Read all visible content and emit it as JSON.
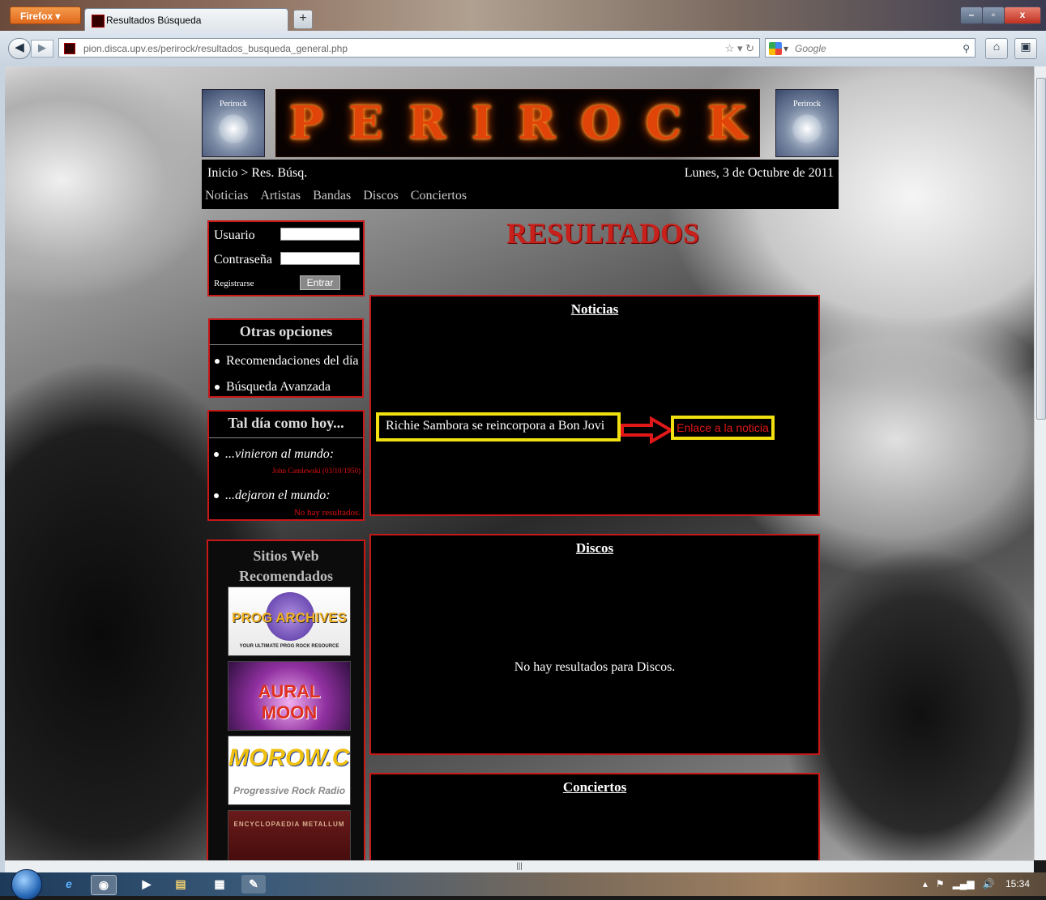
{
  "browser": {
    "menu_button": "Firefox",
    "tab_title": "Resultados Búsqueda",
    "newtab_label": "+",
    "url": "pion.disca.upv.es/perirock/resultados_busqueda_general.php",
    "search_engine_placeholder": "Google",
    "window_buttons": [
      "–",
      "▫",
      "x"
    ]
  },
  "site": {
    "logo_side_text": "Perirock",
    "logo_text": [
      "P",
      "E",
      "R",
      "I",
      "R",
      "O",
      "C",
      "K"
    ],
    "breadcrumb": "Inicio > Res. Búsq.",
    "date": "Lunes, 3 de Octubre de 2011",
    "nav": [
      "Noticias",
      "Artistas",
      "Bandas",
      "Discos",
      "Conciertos"
    ]
  },
  "login": {
    "user_label": "Usuario",
    "password_label": "Contraseña",
    "register_label": "Registrarse",
    "submit_label": "Entrar"
  },
  "options": {
    "title": "Otras opciones",
    "items": [
      "Recomendaciones del día",
      "Búsqueda Avanzada"
    ]
  },
  "on_this_day": {
    "title": "Tal día como hoy...",
    "born_label": "...vinieron al mundo:",
    "born_result": "John Camlewski (03/10/1950)",
    "died_label": "...dejaron el mundo:",
    "died_result": "No hay resultados."
  },
  "recommended": {
    "title_line1": "Sitios Web",
    "title_line2": "Recomendados",
    "banners": [
      "PROG ARCHIVES",
      "AURAL MOON",
      "MOROW.COM",
      "ENCYCLOPAEDIA METALLUM"
    ],
    "banner_subtitles": [
      "YOUR ULTIMATE PROG ROCK RESOURCE",
      "",
      "Progressive Rock Radio",
      ""
    ]
  },
  "results": {
    "title": "RESULTADOS",
    "news": {
      "title": "Noticias",
      "item": "Richie Sambora se reincorpora a Bon Jovi",
      "link": "Enlace a la noticia"
    },
    "albums": {
      "title": "Discos",
      "empty": "No hay resultados para Discos."
    },
    "concerts": {
      "title": "Conciertos"
    }
  },
  "taskbar": {
    "clock": "15:34"
  },
  "colors": {
    "accent_red": "#c81818",
    "highlight_yellow": "#f0e010",
    "title_red": "#c8201a"
  }
}
